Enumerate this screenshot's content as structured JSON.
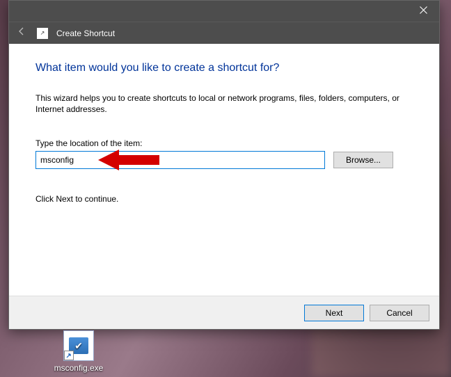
{
  "dialog": {
    "title": "Create Shortcut",
    "heading": "What item would you like to create a shortcut for?",
    "description": "This wizard helps you to create shortcuts to local or network programs, files, folders, computers, or Internet addresses.",
    "location_label": "Type the location of the item:",
    "location_value": "msconfig",
    "browse_label": "Browse...",
    "continue_text": "Click Next to continue.",
    "next_label": "Next",
    "cancel_label": "Cancel"
  },
  "desktop": {
    "icon_label": "msconfig.exe"
  }
}
